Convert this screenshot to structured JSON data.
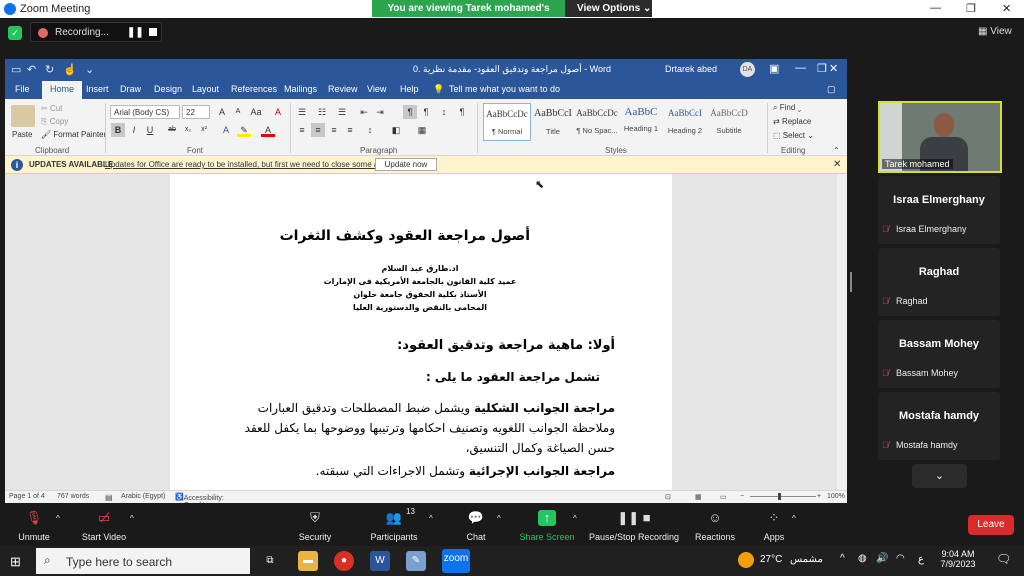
{
  "zoom": {
    "app_title": "Zoom Meeting",
    "banner_text": "You are viewing Tarek mohamed's screen",
    "view_options": "View Options",
    "recording_label": "Recording...",
    "view_label": "View",
    "leave_label": "Leave",
    "participants_count": "13",
    "toolbar": [
      {
        "label": "Unmute",
        "icon": "mic-muted-icon"
      },
      {
        "label": "Start Video",
        "icon": "video-off-icon"
      },
      {
        "label": "Security",
        "icon": "shield-icon"
      },
      {
        "label": "Participants",
        "icon": "people-icon"
      },
      {
        "label": "Chat",
        "icon": "chat-icon"
      },
      {
        "label": "Share Screen",
        "icon": "share-icon"
      },
      {
        "label": "Pause/Stop Recording",
        "icon": "pause-stop-icon"
      },
      {
        "label": "Reactions",
        "icon": "reactions-icon"
      },
      {
        "label": "Apps",
        "icon": "apps-icon"
      }
    ],
    "video_tile_name": "Tarek mohamed",
    "participants": [
      {
        "name": "Israa Elmerghany",
        "sub": "Israa Elmerghany"
      },
      {
        "name": "Raghad",
        "sub": "Raghad"
      },
      {
        "name": "Bassam Mohey",
        "sub": "Bassam Mohey"
      },
      {
        "name": "Mostafa hamdy",
        "sub": "Mostafa hamdy"
      }
    ]
  },
  "word": {
    "doc_title": "0. أصول مراجعة وتدقيق العقود- مقدمة نظرية  -  Word",
    "user": "Drtarek abed",
    "avatar": "DA",
    "tabs": [
      "File",
      "Home",
      "Insert",
      "Draw",
      "Design",
      "Layout",
      "References",
      "Mailings",
      "Review",
      "View",
      "Help"
    ],
    "tell_me": "Tell me what you want to do",
    "clipboard": {
      "paste": "Paste",
      "cut": "Cut",
      "copy": "Copy",
      "format_painter": "Format Painter",
      "group": "Clipboard"
    },
    "font": {
      "name": "Arial (Body CS)",
      "size": "22",
      "group": "Font"
    },
    "paragraph_group": "Paragraph",
    "styles": [
      {
        "sample": "AaBbCcDc",
        "name": "¶ Normal"
      },
      {
        "sample": "AaBbCcI",
        "name": "Title"
      },
      {
        "sample": "AaBbCcDc",
        "name": "¶ No Spac..."
      },
      {
        "sample": "AaBbC",
        "name": "Heading 1"
      },
      {
        "sample": "AaBbCcI",
        "name": "Heading 2"
      },
      {
        "sample": "AaBbCcD",
        "name": "Subtitle"
      }
    ],
    "styles_group": "Styles",
    "editing": {
      "find": "Find",
      "replace": "Replace",
      "select": "Select",
      "group": "Editing"
    },
    "update_bar": {
      "label": "UPDATES AVAILABLE",
      "message": "Updates for Office are ready to be installed, but first we need to close some apps.",
      "button": "Update now"
    },
    "doc": {
      "title": "أصول مراجعة العقود وكشف الثغرات",
      "author_lines": [
        "اد.طارق عبد السلام",
        "عميد كلية القانون بالجامعة الأمريكية فى الإمارات",
        "الأستاذ بكلية الحقوق جامعة حلوان",
        "المحامى بالنقض والدستورية العليا"
      ],
      "h1": "أولا: ماهية مراجعة وتدقيق العقود:",
      "h2": "تشمل مراجعة العقود ما يلى :",
      "p1_bold": "مراجعة الجوانب الشكلية",
      "p1_rest": " ويشمل ضبط المصطلحات وتدقيق العبارات وملاحظة الجوانب اللغويه وتصنيف احكامها وترتيبها ووضوحها بما يكفل للعقد حسن الصياغة وكمال التنسيق،",
      "p2_bold": "مراجعة الجوانب الإجرائية",
      "p2_rest": " وتشمل الاجراءات التي سبقته."
    },
    "status": {
      "page": "Page 1 of 4",
      "words": "767 words",
      "lang": "Arabic (Egypt)",
      "access": "Accessibility: Good to go",
      "zoom": "100%"
    }
  },
  "taskbar": {
    "search_placeholder": "Type here to search",
    "weather": "27°C",
    "weather_text": "مشمس",
    "time": "9:04 AM",
    "date": "7/9/2023",
    "lang": "ع"
  }
}
